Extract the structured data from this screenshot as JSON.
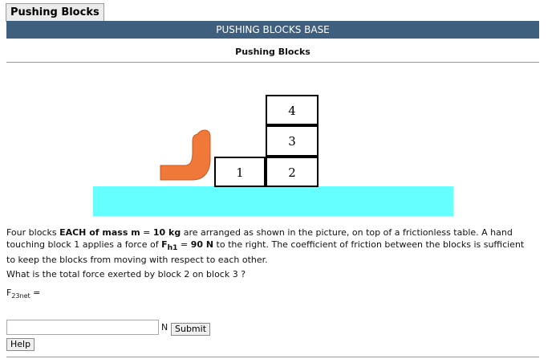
{
  "tab": {
    "label": "Pushing Blocks"
  },
  "header": {
    "bar_title": "PUSHING BLOCKS BASE",
    "subtitle": "Pushing Blocks"
  },
  "figure": {
    "blocks": [
      "1",
      "2",
      "3",
      "4"
    ],
    "colors": {
      "table": "#66ffff",
      "hand": "#f07838",
      "block_border": "#000000"
    }
  },
  "problem": {
    "p1": "Four blocks ",
    "each_of_mass": "EACH of mass m",
    "eq1": " = ",
    "mass": "10 kg",
    "p2": " are arranged as shown in the picture, on top of a frictionless table. A hand touching block 1 applies a force of ",
    "F": "F",
    "h1": "h1",
    "eq2": " = ",
    "force": "90 N",
    "p3": " to the right. The coefficient of friction between the blocks is sufficient to keep the blocks from moving with respect to each other.",
    "question": "What is the total force exerted by block 2 on block 3 ?"
  },
  "answer": {
    "var": "F",
    "sub": "23net",
    "eq": " =",
    "input_value": "",
    "unit": "N",
    "submit_label": "Submit",
    "help_label": "Help"
  }
}
